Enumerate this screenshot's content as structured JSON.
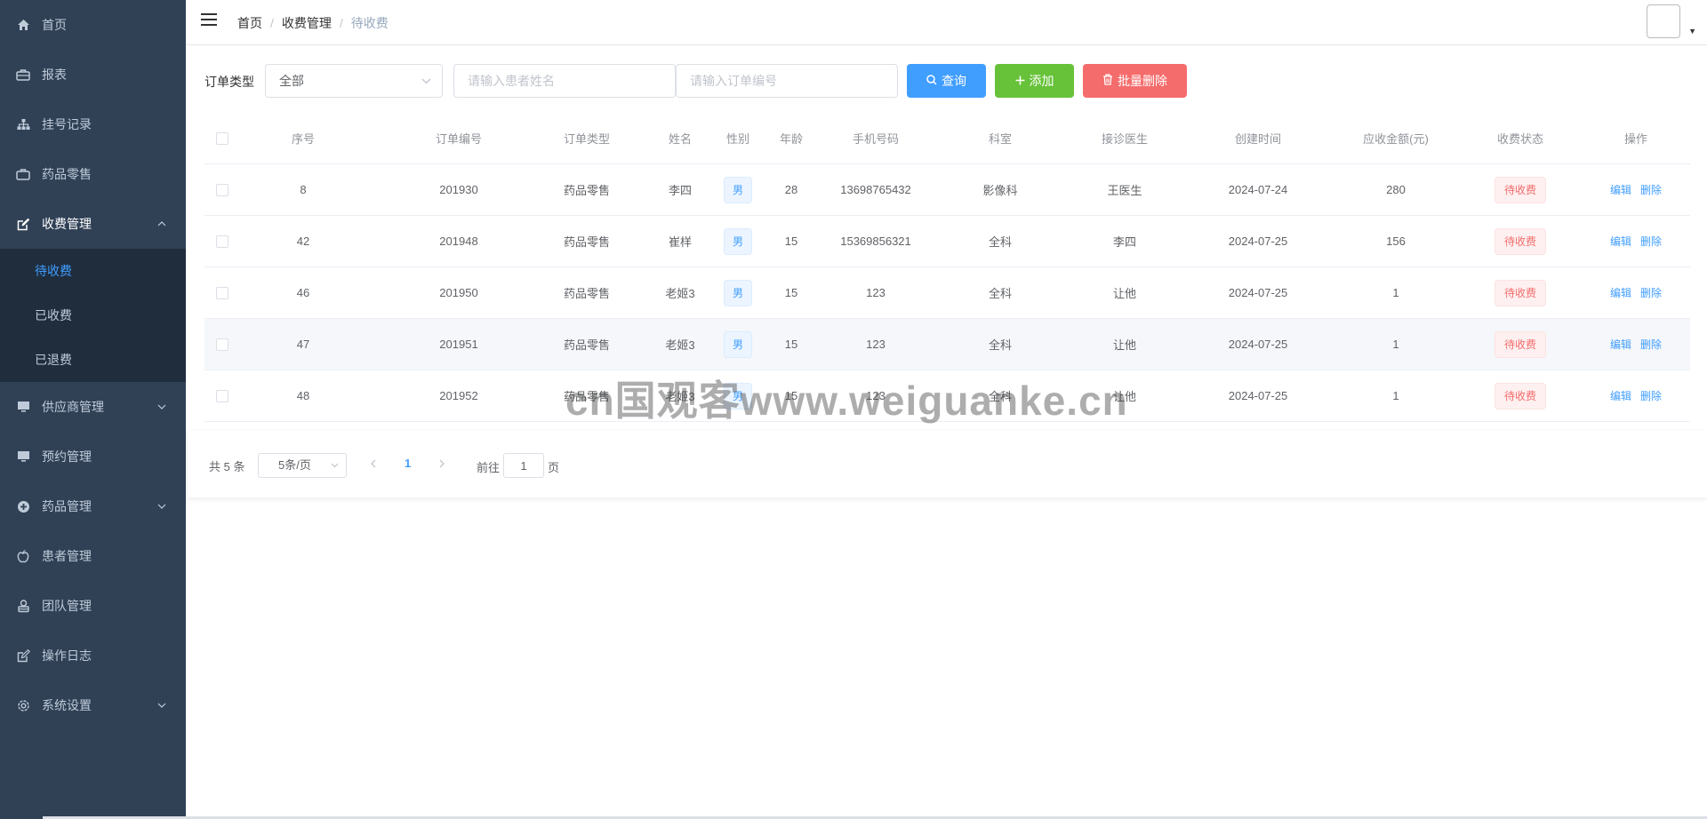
{
  "sidebar": {
    "items": [
      {
        "label": "首页",
        "icon": "home-icon"
      },
      {
        "label": "报表",
        "icon": "briefcase-icon"
      },
      {
        "label": "挂号记录",
        "icon": "sitemap-icon"
      },
      {
        "label": "药品零售",
        "icon": "suitcase-icon"
      },
      {
        "label": "收费管理",
        "icon": "edit-icon"
      },
      {
        "label": "供应商管理",
        "icon": "monitor-icon"
      },
      {
        "label": "预约管理",
        "icon": "monitor-icon"
      },
      {
        "label": "药品管理",
        "icon": "plus-circle-icon"
      },
      {
        "label": "患者管理",
        "icon": "apple-icon"
      },
      {
        "label": "团队管理",
        "icon": "team-icon"
      },
      {
        "label": "操作日志",
        "icon": "log-icon"
      },
      {
        "label": "系统设置",
        "icon": "gear-icon"
      }
    ],
    "submenu": [
      "待收费",
      "已收费",
      "已退费"
    ]
  },
  "breadcrumb": [
    "首页",
    "收费管理",
    "待收费"
  ],
  "filter": {
    "label": "订单类型",
    "select_value": "全部",
    "name_placeholder": "请输入患者姓名",
    "order_placeholder": "请输入订单编号",
    "query_label": "查询",
    "add_label": "添加",
    "batch_delete_label": "批量删除"
  },
  "table": {
    "headers": [
      "序号",
      "订单编号",
      "订单类型",
      "姓名",
      "性别",
      "年龄",
      "手机号码",
      "科室",
      "接诊医生",
      "创建时间",
      "应收金额(元)",
      "收费状态",
      "操作"
    ],
    "rows": [
      {
        "no": "8",
        "order_id": "201930",
        "type": "药品零售",
        "name": "李四",
        "gender": "男",
        "age": "28",
        "phone": "13698765432",
        "dept": "影像科",
        "doctor": "王医生",
        "created": "2024-07-24",
        "amount": "280",
        "status": "待收费"
      },
      {
        "no": "42",
        "order_id": "201948",
        "type": "药品零售",
        "name": "崔样",
        "gender": "男",
        "age": "15",
        "phone": "15369856321",
        "dept": "全科",
        "doctor": "李四",
        "created": "2024-07-25",
        "amount": "156",
        "status": "待收费"
      },
      {
        "no": "46",
        "order_id": "201950",
        "type": "药品零售",
        "name": "老姬3",
        "gender": "男",
        "age": "15",
        "phone": "123",
        "dept": "全科",
        "doctor": "让他",
        "created": "2024-07-25",
        "amount": "1",
        "status": "待收费"
      },
      {
        "no": "47",
        "order_id": "201951",
        "type": "药品零售",
        "name": "老姬3",
        "gender": "男",
        "age": "15",
        "phone": "123",
        "dept": "全科",
        "doctor": "让他",
        "created": "2024-07-25",
        "amount": "1",
        "status": "待收费"
      },
      {
        "no": "48",
        "order_id": "201952",
        "type": "药品零售",
        "name": "老姬3",
        "gender": "男",
        "age": "15",
        "phone": "123",
        "dept": "全科",
        "doctor": "让他",
        "created": "2024-07-25",
        "amount": "1",
        "status": "待收费"
      }
    ],
    "edit_label": "编辑",
    "delete_label": "删除"
  },
  "pagination": {
    "total_text": "共 5 条",
    "page_size": "5条/页",
    "current_page": "1",
    "goto_prefix": "前往",
    "goto_value": "1",
    "goto_suffix": "页"
  },
  "watermark": "cn国观客www.weiguanke.cn",
  "colors": {
    "sidebar_bg": "#304156",
    "submenu_bg": "#1f2d3d",
    "primary": "#409eff",
    "success": "#67c23a",
    "danger": "#f56c6c"
  }
}
